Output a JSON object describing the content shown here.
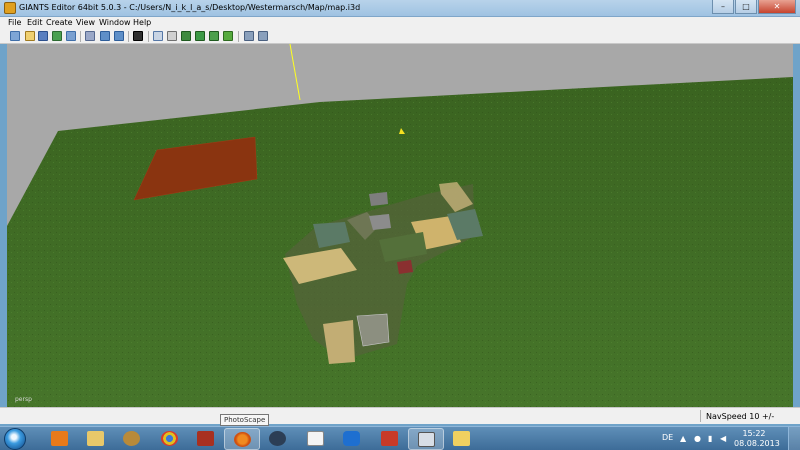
{
  "window": {
    "title": "GIANTS Editor 64bit 5.0.3 - C:/Users/N_i_k_l_a_s/Desktop/Westermarsch/Map/map.i3d",
    "minimize": "–",
    "maximize": "□",
    "close": "✕"
  },
  "menu": {
    "items": [
      {
        "label": "File"
      },
      {
        "label": "Edit"
      },
      {
        "label": "Create"
      },
      {
        "label": "View"
      },
      {
        "label": "Window"
      },
      {
        "label": "Help"
      }
    ]
  },
  "toolbar": {
    "buttons": [
      "new-icon",
      "open-icon",
      "save-icon",
      "save-as-icon",
      "export-icon",
      "select-icon",
      "undo-icon",
      "redo-icon",
      "play-icon",
      "terrain-icon",
      "shape-icon",
      "paint-icon",
      "foliage-icon",
      "fill-icon",
      "grass-icon",
      "settings-icon",
      "settings-alt-icon"
    ]
  },
  "viewport": {
    "camera_label": "persp",
    "sky_color": "#a8a8a8",
    "ground_color": "#3e6a22"
  },
  "status": {
    "navspeed": "NavSpeed 10 +/-"
  },
  "tooltip": {
    "text": "PhotoScape"
  },
  "taskbar": {
    "items": [
      "media-player-icon",
      "file-explorer-icon",
      "media-icon",
      "chrome-icon",
      "game-icon",
      "photoscape-icon",
      "steam-icon",
      "document-icon",
      "teamviewer-icon",
      "presentation-icon",
      "giants-editor-icon",
      "folder-icon"
    ],
    "language": "DE",
    "time": "15:22",
    "date": "08.08.2013"
  }
}
